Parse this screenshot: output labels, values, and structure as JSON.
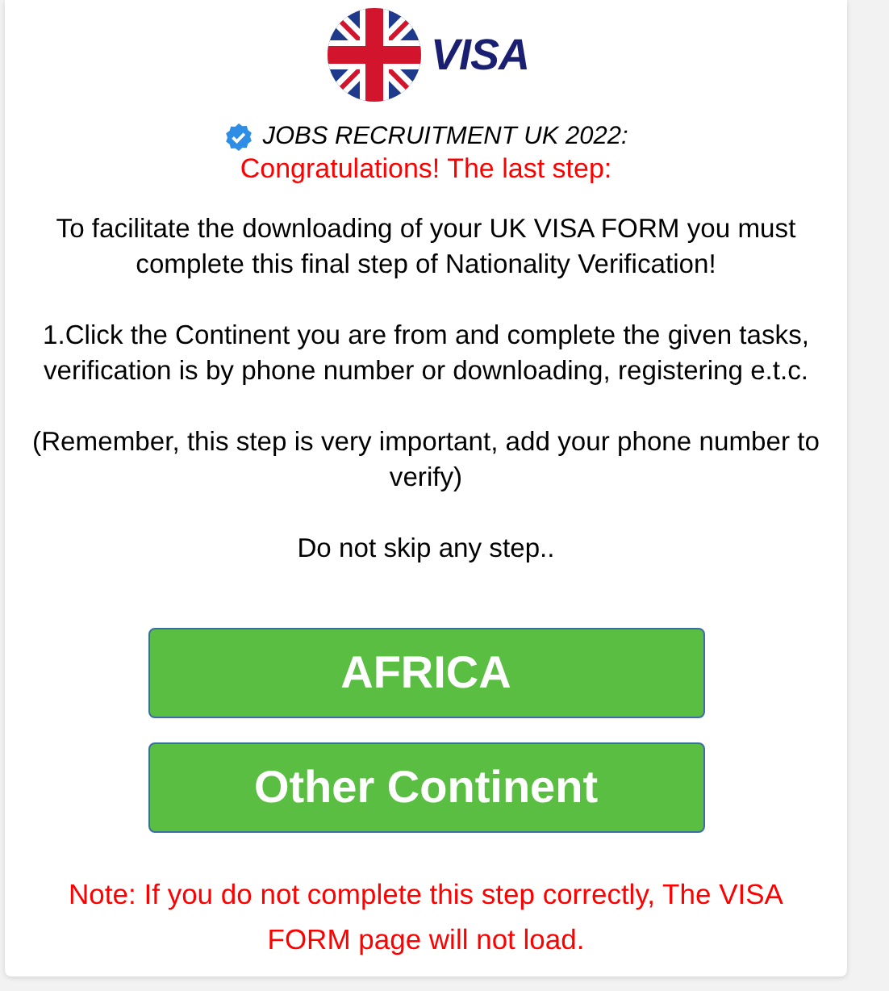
{
  "logo": {
    "text": "VISA"
  },
  "heading": {
    "text": "JOBS RECRUITMENT UK 2022:"
  },
  "subheading": "Congratulations! The last step:",
  "paragraphs": [
    "To facilitate the downloading of your UK VISA FORM you must complete this final step of Nationality Verification!",
    "1.Click the Continent you are from and complete the given tasks, verification is by phone number or downloading, registering e.t.c.",
    "(Remember, this step is very important, add your phone number to verify)",
    "Do not skip any step.."
  ],
  "buttons": [
    "AFRICA",
    "Other Continent"
  ],
  "note": "Note: If you do not complete this step correctly, The VISA FORM page will not load."
}
